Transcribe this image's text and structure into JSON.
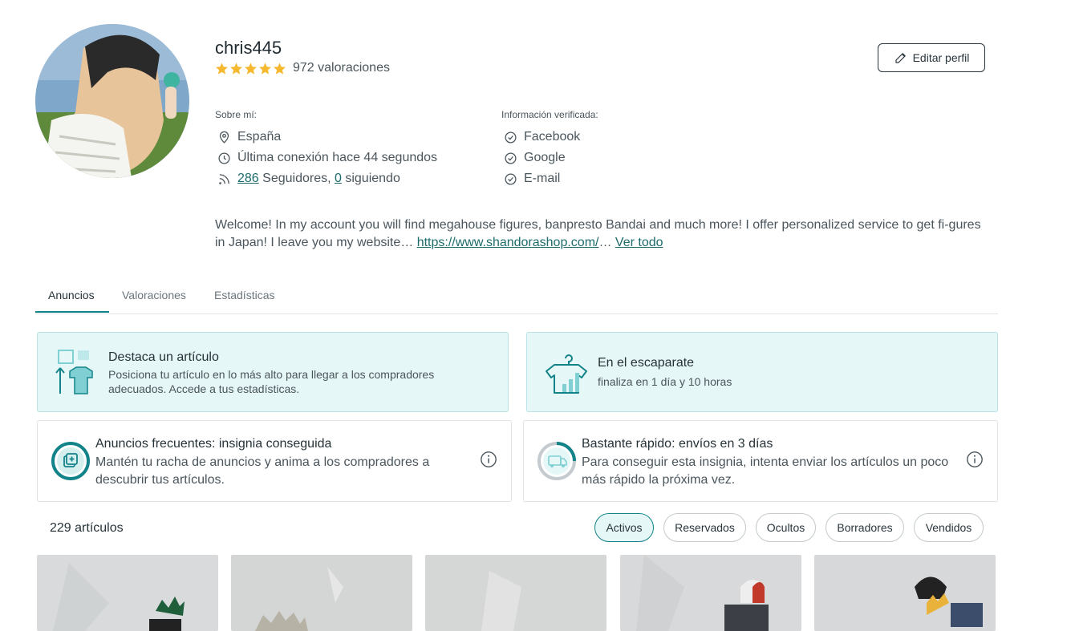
{
  "profile": {
    "username": "chris445",
    "rating_stars": 5,
    "rating_count": "972 valoraciones",
    "edit_label": "Editar perfil"
  },
  "about": {
    "label": "Sobre mí:",
    "location": "España",
    "last_seen": "Última conexión hace 44 segundos",
    "followers_count": "286",
    "followers_label": " Seguidores, ",
    "following_count": "0",
    "following_label": " siguiendo"
  },
  "verified": {
    "label": "Información verificada:",
    "items": [
      "Facebook",
      "Google",
      "E-mail"
    ]
  },
  "bio": {
    "text": "Welcome! In my account you will find megahouse figures, banpresto Bandai and much more! I offer personalized service to get fi-gures in Japan! I leave you my website… ",
    "link": "https://www.shandorashop.com/",
    "ellipsis": "… ",
    "more": "Ver todo"
  },
  "tabs": [
    "Anuncios",
    "Valoraciones",
    "Estadísticas"
  ],
  "promos": {
    "highlight": {
      "title": "Destaca un artículo",
      "subtitle": "Posiciona tu artículo en lo más alto para llegar a los compradores adecuados. Accede a tus estadísticas."
    },
    "showcase": {
      "title": "En el escaparate",
      "subtitle": "finaliza en 1 día y 10 horas"
    }
  },
  "badges": {
    "frequent": {
      "title": "Anuncios frecuentes: insignia conseguida",
      "subtitle": "Mantén tu racha de anuncios y anima a los compradores a descubrir tus artículos."
    },
    "shipping": {
      "title": "Bastante rápido: envíos en 3 días",
      "subtitle": "Para conseguir esta insignia, intenta enviar los artículos un poco más rápido la próxima vez."
    }
  },
  "listings": {
    "count": "229 artículos",
    "filters": [
      "Activos",
      "Reservados",
      "Ocultos",
      "Borradores",
      "Vendidos"
    ],
    "active_filter": "Activos"
  },
  "colors": {
    "accent": "#13838a",
    "star": "#f5b82e",
    "promo_bg": "#e6f7f7"
  }
}
